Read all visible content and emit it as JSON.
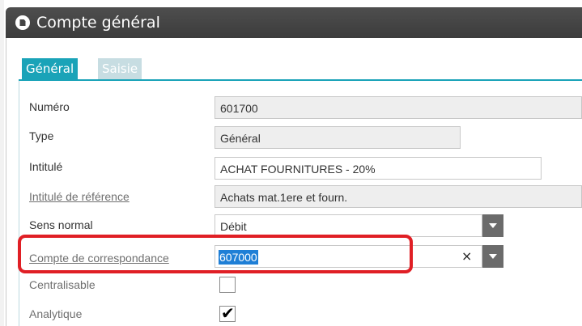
{
  "window": {
    "title": "Compte général",
    "icon": "circle-document-icon"
  },
  "tabs": [
    {
      "label": "Général",
      "active": true
    },
    {
      "label": "Saisie",
      "active": false
    }
  ],
  "fields": {
    "numero": {
      "label": "Numéro",
      "value": "601700"
    },
    "type": {
      "label": "Type",
      "value": "Général"
    },
    "intitule": {
      "label": "Intitulé",
      "value": "ACHAT FOURNITURES - 20%"
    },
    "intitule_reference": {
      "label": "Intitulé de référence",
      "value": "Achats mat.1ere et fourn."
    },
    "sens_normal": {
      "label": "Sens normal",
      "value": "Débit"
    },
    "compte_correspondance": {
      "label": "Compte de correspondance",
      "value": "607000"
    },
    "centralisable": {
      "label": "Centralisable",
      "checked": false
    },
    "analytique": {
      "label": "Analytique",
      "checked": true
    }
  },
  "glyphs": {
    "clear": "×",
    "check": "✔"
  },
  "colors": {
    "accent": "#1aa3b8",
    "highlight": "#e01f25",
    "titlebar": "#444444"
  }
}
